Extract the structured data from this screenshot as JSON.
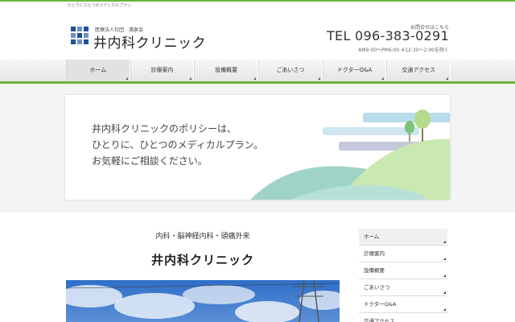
{
  "header": {
    "tagline": "ひとりにひとつのメディカルプラン",
    "corp": "医療法人社団　満泉会",
    "clinic_name": "井内科クリニック",
    "contact_label": "お問合せはこちら",
    "tel": "TEL 096-383-0291",
    "hours": "AM9:00〜PM6:00 ※12:30〜2:00を除く"
  },
  "nav": {
    "items": [
      "ホーム",
      "診療案内",
      "設備概要",
      "ごあいさつ",
      "ドクターQ&A",
      "交通アクセス"
    ]
  },
  "hero": {
    "line1": "井内科クリニックのポリシーは、",
    "line2": "ひとりに、ひとつのメディカルプラン。",
    "line3": "お気軽にご相談ください。"
  },
  "content": {
    "category": "内科・脳神経内科・頭痛外来",
    "title": "井内科クリニック"
  },
  "sidebar": {
    "items": [
      "ホーム",
      "診療案内",
      "設備概要",
      "ごあいさつ",
      "ドクターQ&A",
      "交通アクセス"
    ]
  },
  "colors": {
    "accent": "#6bb33f",
    "logo": "#1e4f9c"
  }
}
